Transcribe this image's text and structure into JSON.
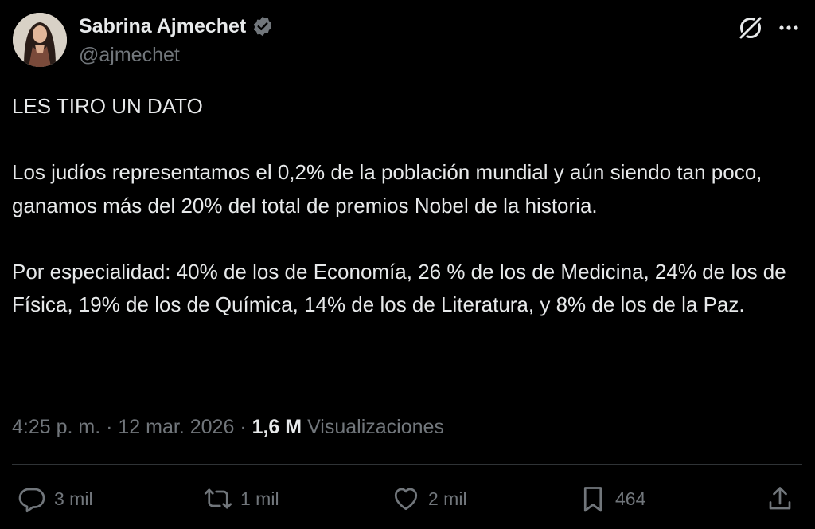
{
  "author": {
    "name": "Sabrina Ajmechet",
    "handle": "@ajmechet",
    "verified": true,
    "verified_color": "#71767b"
  },
  "tweet": {
    "text": "LES TIRO UN DATO\n\nLos judíos representamos el 0,2% de la población mundial y aún siendo tan poco, ganamos más del 20% del total de premios Nobel de la historia.\n\nPor especialidad: 40% de los de Economía, 26 % de los de Medicina, 24% de los de Física, 19% de los de Química, 14% de los de Literatura, y 8% de los de la Paz."
  },
  "meta": {
    "time": "4:25 p. m.",
    "separator": "·",
    "date": "12 mar. 2026",
    "views_count": "1,6 M",
    "views_label": "Visualizaciones"
  },
  "actions": {
    "replies": "3 mil",
    "reposts": "1 mil",
    "likes": "2 mil",
    "bookmarks": "464"
  },
  "icons": {
    "top_right": [
      "grok-icon",
      "more-icon"
    ],
    "action_bar": [
      "reply-icon",
      "repost-icon",
      "like-icon",
      "bookmark-icon",
      "share-icon"
    ]
  },
  "colors": {
    "background": "#000000",
    "text_primary": "#e7e9ea",
    "text_secondary": "#71767b",
    "divider": "#2f3336"
  }
}
